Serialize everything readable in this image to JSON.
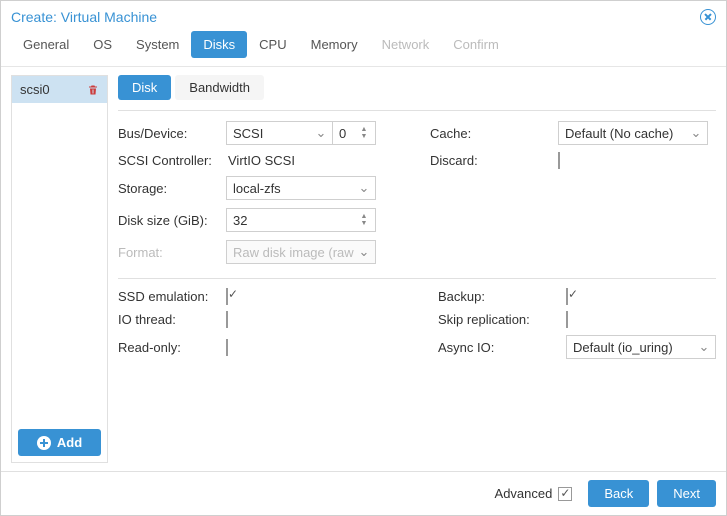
{
  "title": "Create: Virtual Machine",
  "tabs": [
    "General",
    "OS",
    "System",
    "Disks",
    "CPU",
    "Memory",
    "Network",
    "Confirm"
  ],
  "active_tab": "Disks",
  "disabled_tabs": [
    "Network",
    "Confirm"
  ],
  "sidebar": {
    "items": [
      {
        "label": "scsi0"
      }
    ],
    "add_label": "Add"
  },
  "subtabs": [
    "Disk",
    "Bandwidth"
  ],
  "active_subtab": "Disk",
  "form": {
    "bus_device_label": "Bus/Device:",
    "bus_type": "SCSI",
    "bus_number": "0",
    "scsi_controller_label": "SCSI Controller:",
    "scsi_controller": "VirtIO SCSI",
    "storage_label": "Storage:",
    "storage": "local-zfs",
    "disk_size_label": "Disk size (GiB):",
    "disk_size": "32",
    "format_label": "Format:",
    "format": "Raw disk image (raw",
    "cache_label": "Cache:",
    "cache": "Default (No cache)",
    "discard_label": "Discard:",
    "ssd_emulation_label": "SSD emulation:",
    "io_thread_label": "IO thread:",
    "read_only_label": "Read-only:",
    "backup_label": "Backup:",
    "skip_replication_label": "Skip replication:",
    "async_io_label": "Async IO:",
    "async_io": "Default (io_uring)"
  },
  "checkboxes": {
    "discard": false,
    "ssd_emulation": true,
    "io_thread": false,
    "read_only": false,
    "backup": true,
    "skip_replication": false,
    "advanced": true
  },
  "footer": {
    "advanced_label": "Advanced",
    "back_label": "Back",
    "next_label": "Next"
  }
}
